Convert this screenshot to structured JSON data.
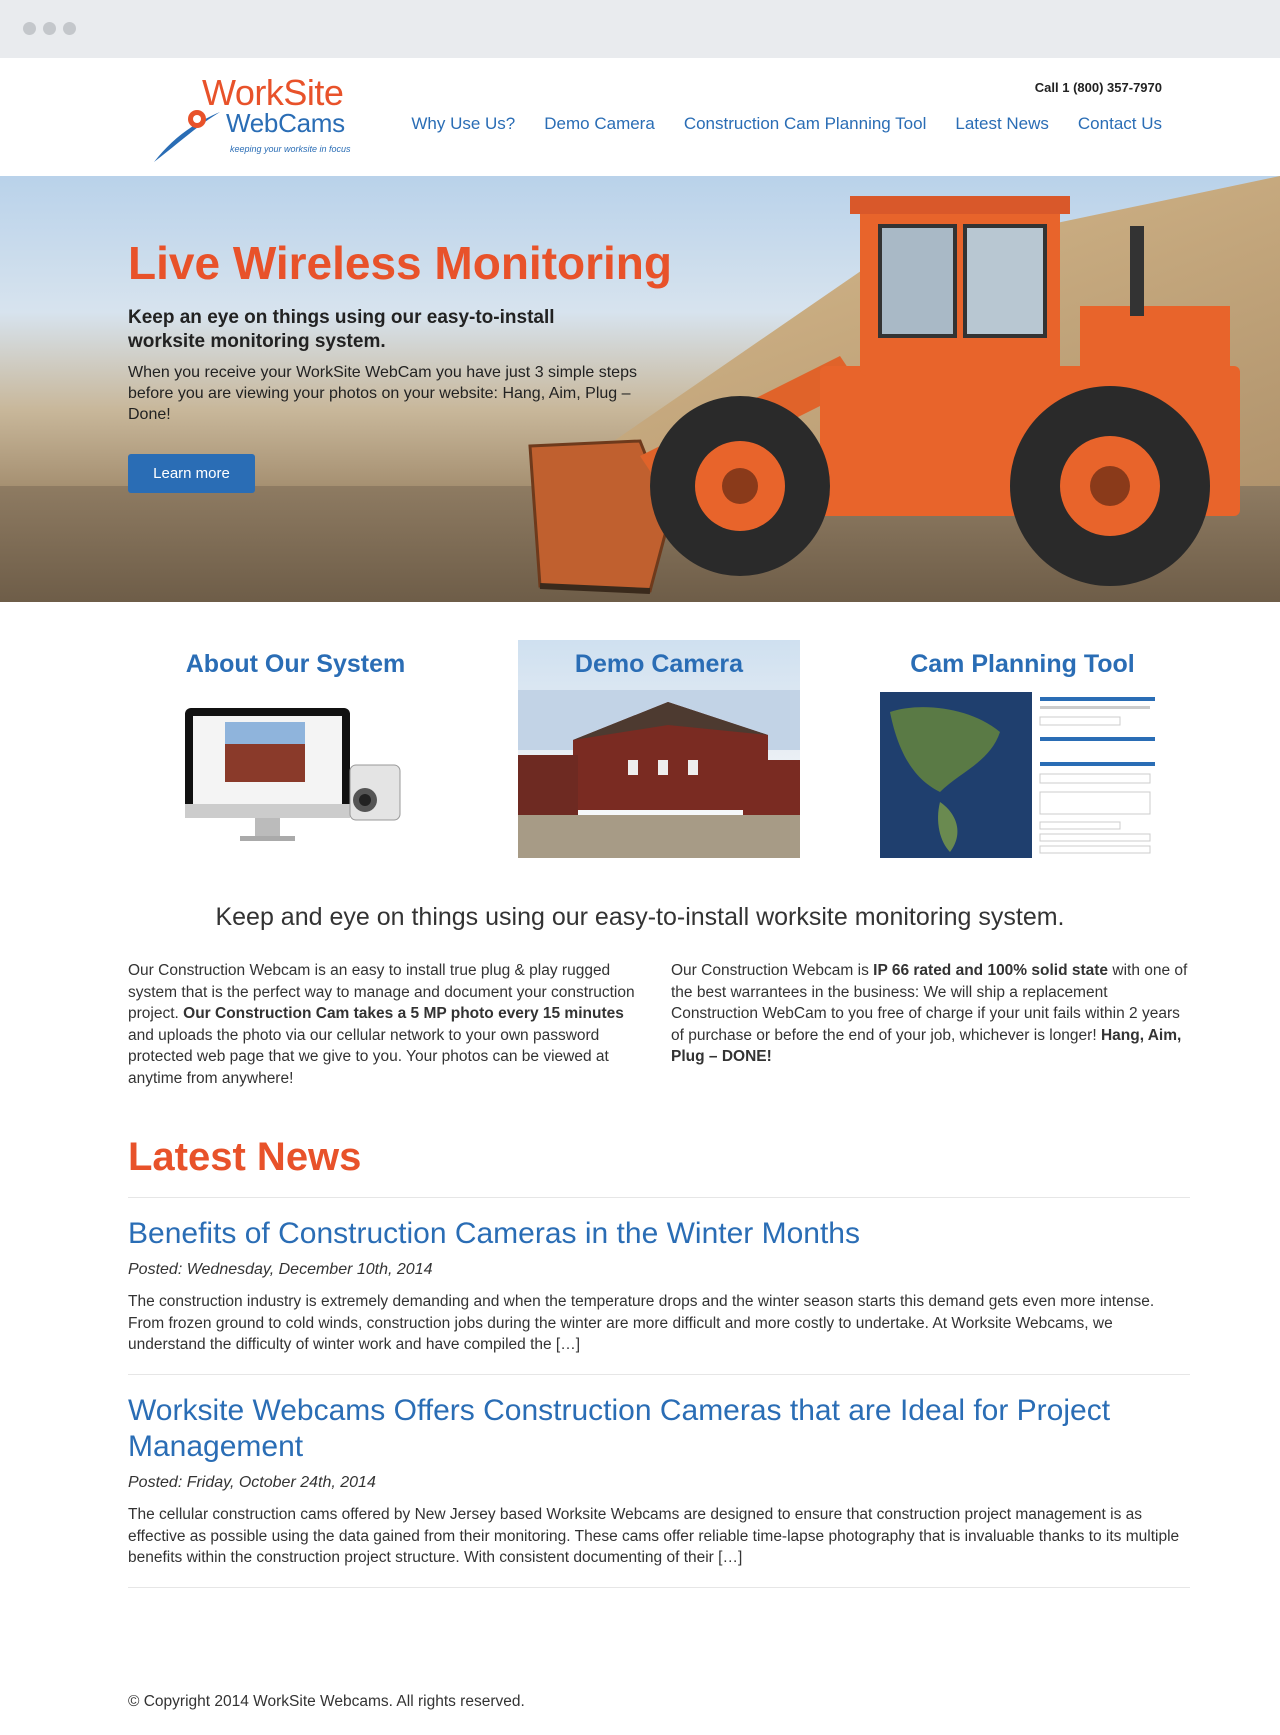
{
  "header": {
    "logo": {
      "line1": "WorkSite",
      "line2": "WebCams",
      "tagline": "keeping your worksite in focus"
    },
    "phone": "Call 1 (800) 357-7970",
    "nav": [
      "Why Use Us?",
      "Demo Camera",
      "Construction Cam Planning Tool",
      "Latest News",
      "Contact Us"
    ]
  },
  "hero": {
    "title": "Live Wireless Monitoring",
    "subtitle": "Keep an eye on things using our easy-to-install worksite monitoring system.",
    "body": "When you receive your WorkSite WebCam you have just 3 simple steps before you are viewing your photos on your website: Hang, Aim, Plug – Done!",
    "button": "Learn more"
  },
  "features": [
    {
      "title": "About Our System"
    },
    {
      "title": "Demo Camera"
    },
    {
      "title": "Cam Planning Tool"
    }
  ],
  "intro": {
    "title": "Keep and eye on things using our easy-to-install worksite monitoring system.",
    "left": {
      "p1": "Our Construction Webcam is an easy to install true plug & play rugged system that is the perfect way to manage and document your construction project. ",
      "bold": "Our Construction Cam takes a 5 MP photo every 15 minutes",
      "p2": " and uploads the photo via our cellular network to your own password protected web page that we give to you. Your photos can be viewed at anytime from anywhere!"
    },
    "right": {
      "p1": "Our Construction Webcam is ",
      "bold1": "IP 66 rated and 100% solid state",
      "p2": " with one of the best warrantees in the business: We will ship a replacement Construction WebCam to you free of charge if your unit fails within 2 years of purchase or before the end of your job, whichever is longer! ",
      "bold2": "Hang, Aim, Plug – DONE!"
    }
  },
  "news": {
    "heading": "Latest News",
    "posts": [
      {
        "title": "Benefits of Construction Cameras in the Winter Months",
        "date": "Posted: Wednesday, December 10th, 2014",
        "excerpt": "The construction industry is extremely demanding and when the temperature drops and the winter season starts this demand gets even more intense. From frozen ground to cold winds, construction jobs during the winter are more difficult and more costly to undertake. At Worksite Webcams, we understand the difficulty of winter work and have compiled the […]"
      },
      {
        "title": "Worksite Webcams Offers Construction Cameras that are Ideal for Project Management",
        "date": "Posted: Friday, October 24th, 2014",
        "excerpt": "The cellular construction cams offered by New Jersey based Worksite Webcams are designed to ensure that construction project management is as effective as possible using the data gained from their monitoring. These cams offer reliable time-lapse photography that is invaluable thanks to its multiple benefits within the construction project structure. With consistent documenting of their […]"
      }
    ]
  },
  "footer": {
    "copyright": "© Copyright 2014 WorkSite Webcams. All rights reserved."
  },
  "colors": {
    "accent": "#e8522a",
    "brand": "#2a6db5",
    "text": "#333333"
  }
}
